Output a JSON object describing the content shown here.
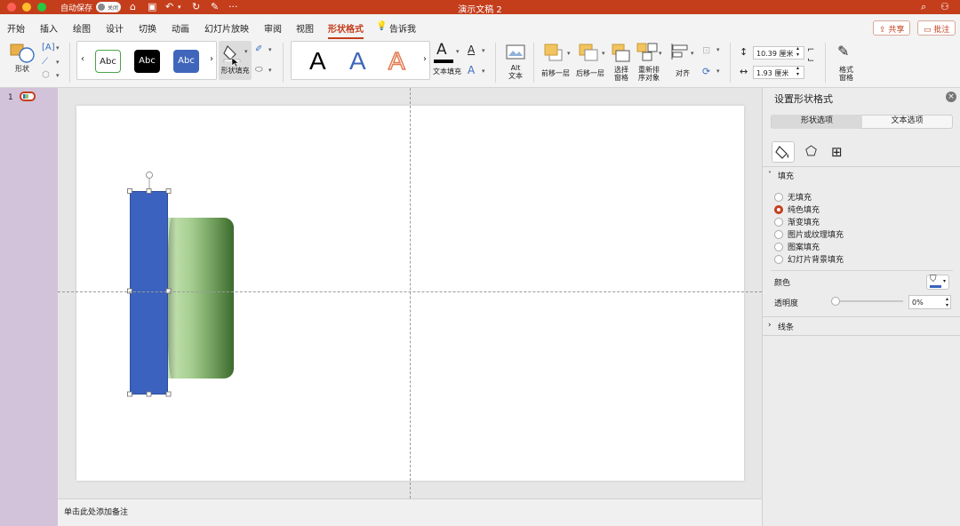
{
  "window": {
    "title": "演示文稿 2",
    "autosave_label": "自动保存",
    "autosave_state": "关闭"
  },
  "menu": {
    "tabs": [
      "开始",
      "插入",
      "绘图",
      "设计",
      "切换",
      "动画",
      "幻灯片放映",
      "审阅",
      "视图",
      "形状格式"
    ],
    "tell_me": "告诉我",
    "share": "共享",
    "comments": "批注"
  },
  "ribbon": {
    "shape_label": "形状",
    "style_previews": [
      "Abc",
      "Abc",
      "Abc"
    ],
    "shape_fill_label": "形状填充",
    "wordart_letters": [
      "A",
      "A",
      "A"
    ],
    "text_fill_label": "文本填充",
    "alt_text_label": "Alt\n文本",
    "bring_forward": "前移一层",
    "send_backward": "后移一层",
    "selection_pane": "选择\n窗格",
    "reorder": "重新排\n序对象",
    "align": "对齐",
    "height_value": "10.39 厘米",
    "width_value": "1.93 厘米",
    "format_pane": "格式\n窗格"
  },
  "slides": {
    "number": "1"
  },
  "notes": {
    "placeholder": "单击此处添加备注"
  },
  "format_panel": {
    "title": "设置形状格式",
    "tab_shape": "形状选项",
    "tab_text": "文本选项",
    "fill_section": "填充",
    "fill_options": [
      "无填充",
      "纯色填充",
      "渐变填充",
      "图片或纹理填充",
      "图案填充",
      "幻灯片背景填充"
    ],
    "selected_fill": "纯色填充",
    "color_label": "颜色",
    "transparency_label": "透明度",
    "transparency_value": "0%",
    "line_section": "线条"
  },
  "colors": {
    "accent": "#c43e1c",
    "blue_shape": "#3b62be",
    "green_shape_light": "#c6e0b4",
    "green_shape_dark": "#3d6b2f"
  }
}
